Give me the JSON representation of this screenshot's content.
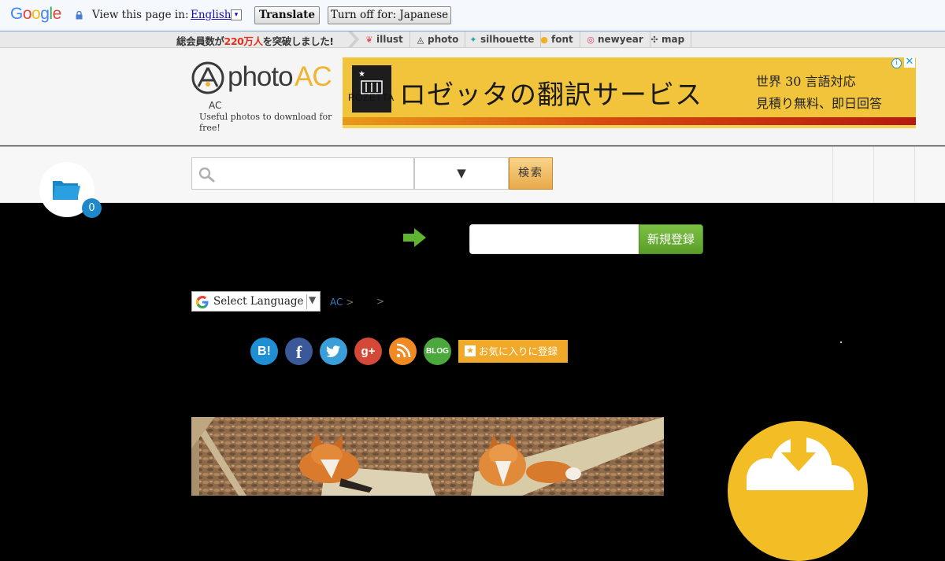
{
  "translate_bar": {
    "logo": [
      "G",
      "o",
      "o",
      "g",
      "l",
      "e"
    ],
    "logo_colors": [
      "#4285f4",
      "#ea4335",
      "#fbbc05",
      "#4285f4",
      "#34a853",
      "#ea4335"
    ],
    "prompt": "View this page in:",
    "language": "English",
    "translate_label": "Translate",
    "turn_off_label": "Turn off for: Japanese"
  },
  "nav_strip": {
    "member_text_prefix": "総会員数が",
    "member_count": "220万人",
    "member_text_suffix": "を突破しました!",
    "items": [
      {
        "label": "illust",
        "icon": "illust-icon"
      },
      {
        "label": "photo",
        "icon": "photo-icon"
      },
      {
        "label": "silhouette",
        "icon": "silhouette-icon"
      },
      {
        "label": "font",
        "icon": "font-icon"
      },
      {
        "label": "newyear",
        "icon": "newyear-icon"
      },
      {
        "label": "map",
        "icon": "map-icon"
      }
    ]
  },
  "header": {
    "logo_photo": "photo",
    "logo_ac": "AC",
    "logo_sub": "AC",
    "tagline": "Useful photos to download for free!",
    "ad": {
      "brand": "ROZETTA",
      "headline": "ロゼッタの翻訳サービス",
      "side_line1": "世界 30 言語対応",
      "side_line2": "見積り無料、即日回答",
      "info": "i",
      "close": "✕"
    }
  },
  "search": {
    "input_value": "",
    "select_arrow": "▼",
    "button_label": "検索"
  },
  "favorites": {
    "count": "0"
  },
  "register": {
    "input_value": "",
    "button_label": "新規登録"
  },
  "language_select": {
    "label": "Select Language",
    "arrow": "▼"
  },
  "breadcrumb": {
    "first": "AC",
    "sep": ">",
    "second_sep": ">"
  },
  "social": {
    "buttons": [
      {
        "label": "B!",
        "color": "#1f8fd4",
        "icon": "hatena-icon"
      },
      {
        "label": "f",
        "color": "#3b5998",
        "icon": "facebook-icon"
      },
      {
        "label": "t",
        "color": "#3a9fd9",
        "icon": "twitter-icon"
      },
      {
        "label": "g+",
        "color": "#d34836",
        "icon": "googleplus-icon"
      },
      {
        "label": "rss",
        "color": "#f08a23",
        "icon": "rss-icon"
      },
      {
        "label": "BLOG",
        "color": "#4aa83c",
        "icon": "blog-icon"
      }
    ],
    "favorite_label": "お気に入りに登録"
  },
  "colors": {
    "accent_orange": "#f0a928",
    "register_green": "#5a9e28",
    "badge_blue": "#1e88c8"
  }
}
